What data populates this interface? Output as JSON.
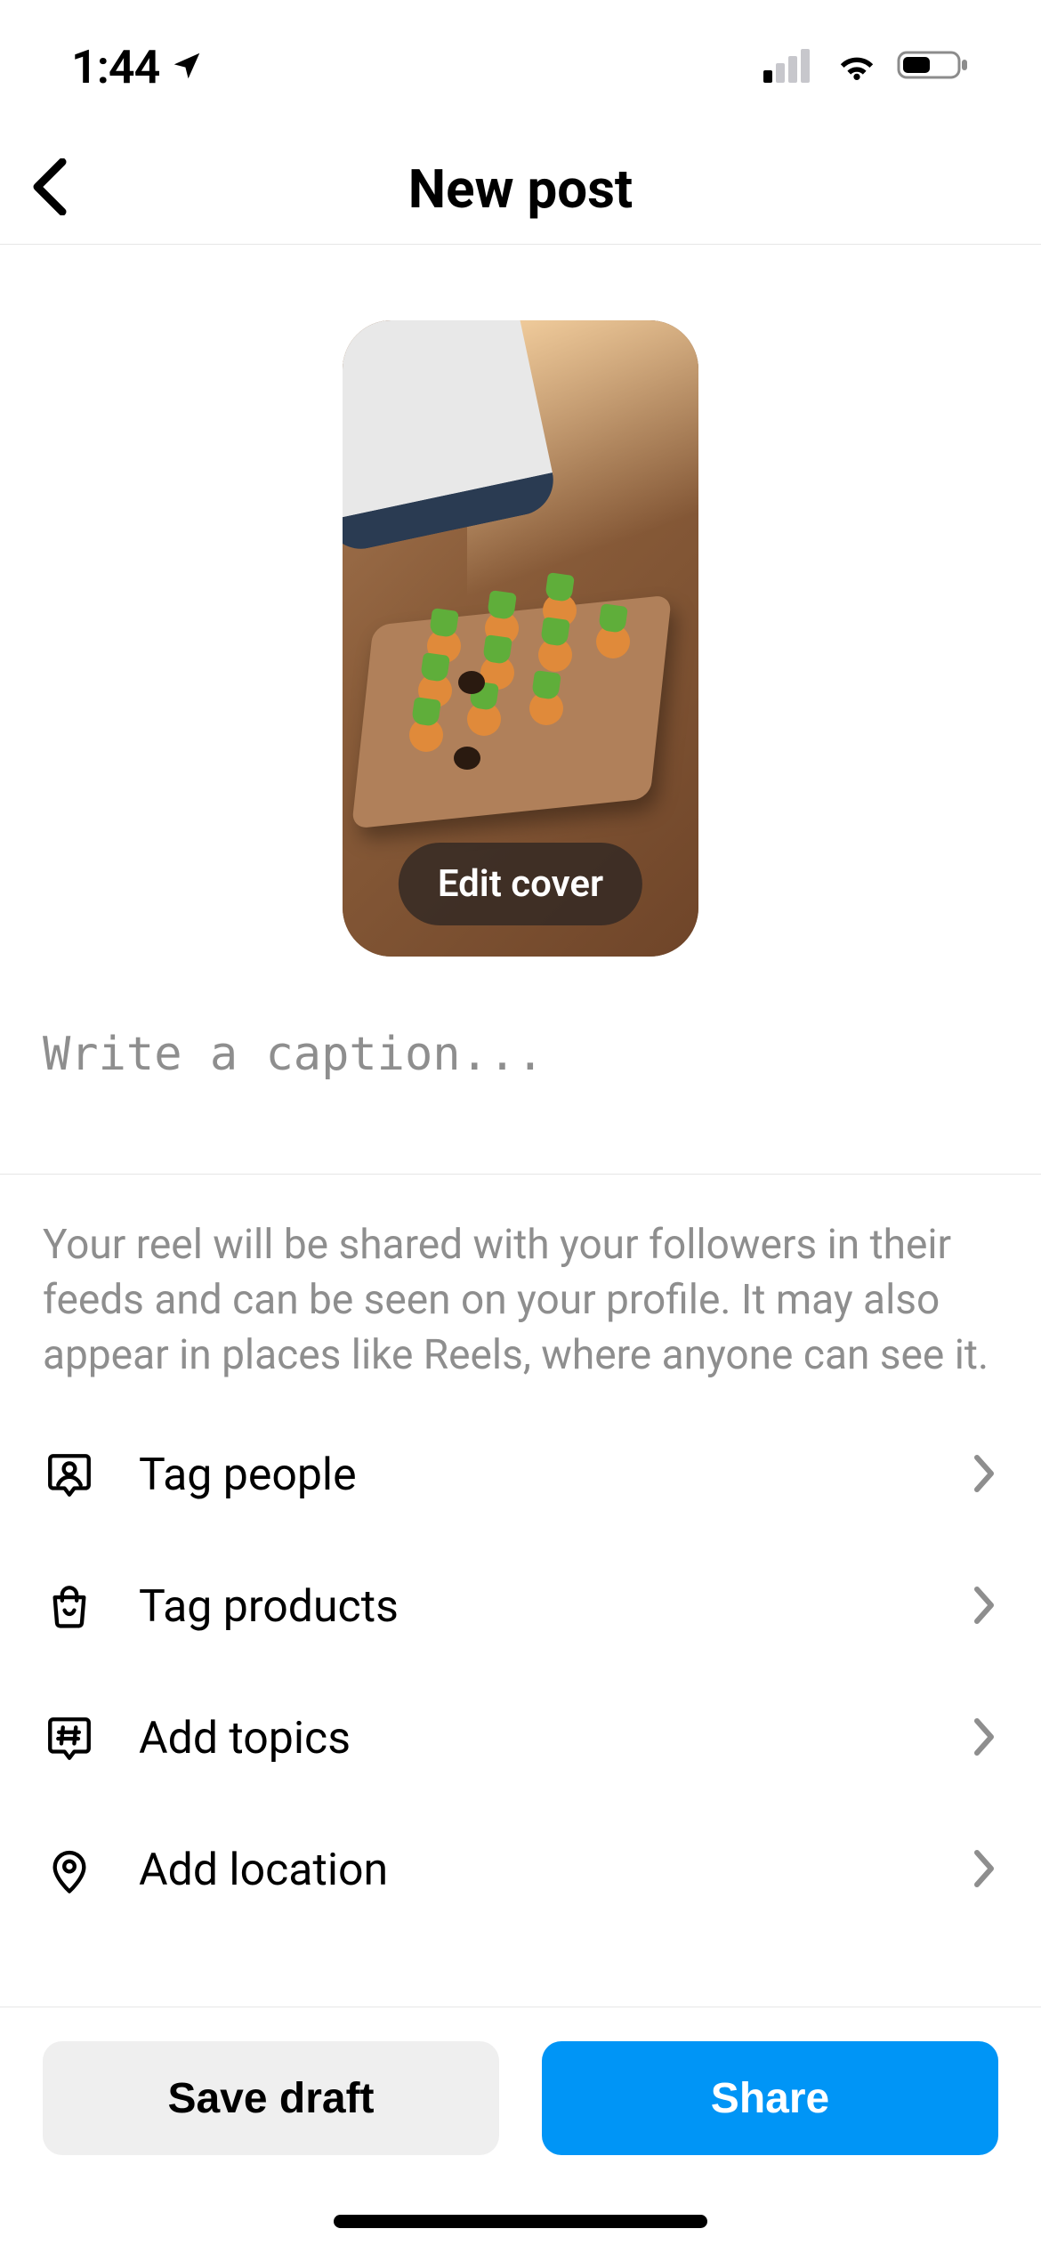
{
  "status": {
    "time": "1:44"
  },
  "header": {
    "title": "New post"
  },
  "preview": {
    "edit_cover_label": "Edit cover"
  },
  "caption": {
    "placeholder": "Write a caption..."
  },
  "disclaimer": "Your reel will be shared with your followers in their feeds and can be seen on your profile. It may also appear in places like Reels, where anyone can see it.",
  "options": {
    "tag_people": "Tag people",
    "tag_products": "Tag products",
    "add_topics": "Add topics",
    "add_location": "Add location"
  },
  "footer": {
    "save_draft_label": "Save draft",
    "share_label": "Share"
  }
}
